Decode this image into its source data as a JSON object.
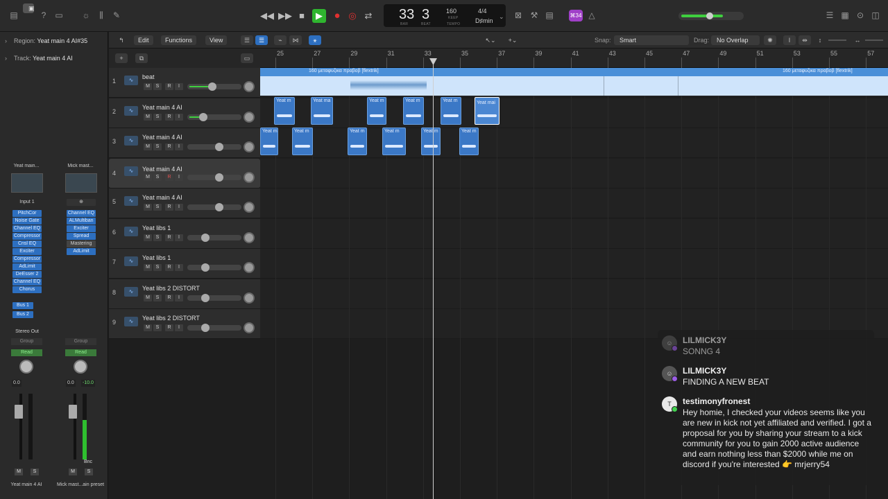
{
  "top_bar": {
    "lcd": {
      "bar": "33",
      "beat": "3",
      "bar_label": "BAR",
      "beat_label": "BEAT",
      "tempo": "160",
      "tempo_label": "TEMPO",
      "keep": "KEEP",
      "time_sig": "4/4",
      "key": "D♯min"
    },
    "cpu_badge": "⌘34",
    "colors": {
      "play": "#2fb52f",
      "record": "#e03030",
      "badge": "#a040c8",
      "accent": "#2d6fc0"
    }
  },
  "inspector": {
    "region_label": "Region:",
    "region_value": "Yeat main 4 AI#35",
    "track_label": "Track:",
    "track_value": "Yeat main 4 AI"
  },
  "channel_strips": [
    {
      "name": "Yeat main...",
      "input": "Input 1",
      "plugins": [
        "PitchCor",
        "Noise Gate",
        "Channel EQ",
        "Compressor",
        "Cnsl EQ",
        "Exciter",
        "Compressor",
        "AdLimit",
        "DeEsser 2",
        "Channel EQ",
        "Chorus"
      ],
      "sends": [
        "Bus 1",
        "Bus 2"
      ],
      "output": "Stereo Out",
      "group": "Group",
      "automation": "Read",
      "value1": "0.0",
      "value2": "",
      "mute": "M",
      "solo": "S",
      "footer": "Yeat main 4 AI"
    },
    {
      "name": "Mick mast...",
      "input": "",
      "plugins": [
        "Channel EQ",
        "ALMultiban",
        "Exciter",
        "Spread",
        "Mastering",
        "AdLimit"
      ],
      "sends": [],
      "output": "",
      "group": "Group",
      "automation": "Read",
      "value1": "0.0",
      "value2": "-10.0",
      "bnc": "Bnc",
      "mute": "M",
      "solo": "S",
      "footer": "Mick mast...ain preset"
    }
  ],
  "toolbar": {
    "edit": "Edit",
    "functions": "Functions",
    "view": "View",
    "snap_label": "Snap:",
    "snap_value": "Smart",
    "drag_label": "Drag:",
    "drag_value": "No Overlap"
  },
  "ruler": [
    "25",
    "27",
    "29",
    "31",
    "33",
    "35",
    "37",
    "39",
    "41",
    "43",
    "45",
    "47",
    "49",
    "51",
    "53",
    "55",
    "57"
  ],
  "tracks": [
    {
      "num": "1",
      "name": "beat",
      "vol": 0.45
    },
    {
      "num": "2",
      "name": "Yeat main 4 AI",
      "vol": 0.25
    },
    {
      "num": "3",
      "name": "Yeat main 4 AI",
      "vol": 0.6
    },
    {
      "num": "4",
      "name": "Yeat main 4 AI",
      "vol": 0.6
    },
    {
      "num": "5",
      "name": "Yeat main 4 AI",
      "vol": 0.6
    },
    {
      "num": "6",
      "name": "Yeat libs 1",
      "vol": 0.3
    },
    {
      "num": "7",
      "name": "Yeat libs 1",
      "vol": 0.3
    },
    {
      "num": "8",
      "name": "Yeat libs 2 DISTORT",
      "vol": 0.3
    },
    {
      "num": "9",
      "name": "Yeat libs 2 DISTORT",
      "vol": 0.3
    }
  ],
  "track_buttons": {
    "m": "M",
    "s": "S",
    "r": "R",
    "i": "I"
  },
  "beat_region": {
    "title_a": "160 μεταφυζικα πραβοβ [flextrik]",
    "title_b": "160 μεταφυζικα πραβοβ [flextrik]"
  },
  "regions_track2": [
    "Yeat m",
    "Yeat ma",
    "Yeat m",
    "Yeat m",
    "Yeat m",
    "Yeat mai"
  ],
  "regions_track3": [
    "Yeat ma",
    "Yeat m",
    "Yeat m",
    "Yeat m",
    "Yeat m",
    "Yeat m"
  ],
  "chat": [
    {
      "user": "LILMICK3Y",
      "text": "SONNG 4"
    },
    {
      "user": "LILMICK3Y",
      "text": "FINDING A NEW BEAT"
    },
    {
      "user": "testimonyfronest",
      "avatar": "T",
      "text": "Hey homie, I checked your videos seems like you are new in kick not yet affiliated and verified. I got a proposal for you by sharing your stream to a kick community for you to gain 2000 active audience and earn nothing less than $2000 while me on discord if you're interested 👉 mrjerry54"
    }
  ]
}
